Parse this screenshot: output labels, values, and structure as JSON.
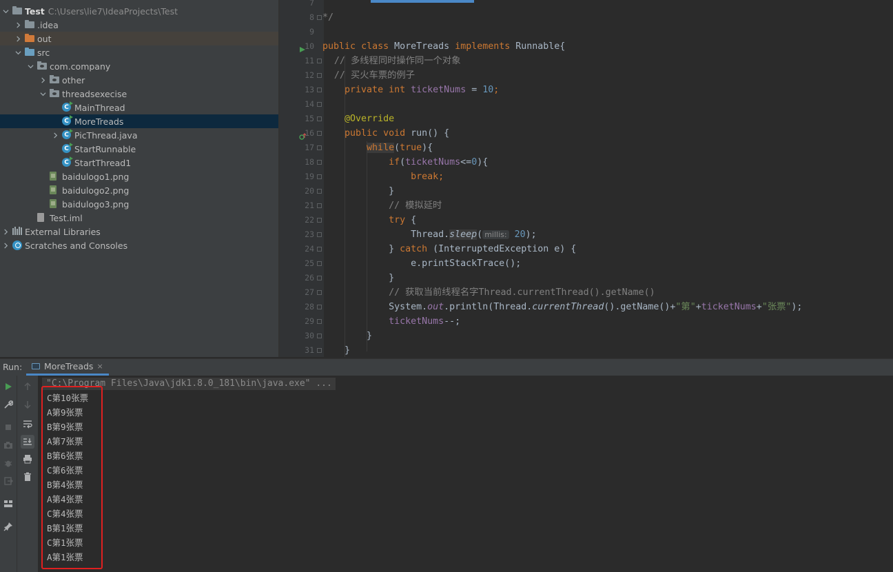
{
  "project_tree": [
    {
      "name": "Test",
      "path": "C:\\Users\\lie7\\IdeaProjects\\Test",
      "icon": "module-folder-icon",
      "expanded": true,
      "bold": true,
      "depth": 0,
      "key": "test-root"
    },
    {
      "name": ".idea",
      "icon": "folder-icon",
      "expanded": false,
      "depth": 1,
      "key": "idea"
    },
    {
      "name": "out",
      "icon": "output-folder-icon",
      "expanded": false,
      "depth": 1,
      "key": "out"
    },
    {
      "name": "src",
      "icon": "source-folder-icon",
      "expanded": true,
      "depth": 1,
      "key": "src"
    },
    {
      "name": "com.company",
      "icon": "package-icon",
      "expanded": true,
      "depth": 2,
      "key": "com-company"
    },
    {
      "name": "other",
      "icon": "package-icon",
      "expanded": false,
      "depth": 3,
      "key": "other"
    },
    {
      "name": "threadsexecise",
      "icon": "package-icon",
      "expanded": true,
      "depth": 3,
      "key": "threadsexecise"
    },
    {
      "name": "MainThread",
      "icon": "java-class-icon",
      "depth": 4,
      "key": "mainthread"
    },
    {
      "name": "MoreTreads",
      "icon": "java-class-icon",
      "depth": 4,
      "selected": true,
      "key": "moretreads"
    },
    {
      "name": "PicThread.java",
      "icon": "java-class-icon",
      "expanded": false,
      "depth": 4,
      "key": "picthread"
    },
    {
      "name": "StartRunnable",
      "icon": "java-class-icon",
      "depth": 4,
      "key": "startrunnable"
    },
    {
      "name": "StartThread1",
      "icon": "java-class-icon",
      "depth": 4,
      "key": "startthread1"
    },
    {
      "name": "baidulogo1.png",
      "icon": "image-file-icon",
      "depth": 3,
      "key": "baidulogo1"
    },
    {
      "name": "baidulogo2.png",
      "icon": "image-file-icon",
      "depth": 3,
      "key": "baidulogo2"
    },
    {
      "name": "baidulogo3.png",
      "icon": "image-file-icon",
      "depth": 3,
      "key": "baidulogo3"
    },
    {
      "name": "Test.iml",
      "icon": "iml-file-icon",
      "depth": 2,
      "key": "test-iml"
    },
    {
      "name": "External Libraries",
      "icon": "library-icon",
      "expanded": false,
      "depth": 0,
      "key": "external-libraries"
    },
    {
      "name": "Scratches and Consoles",
      "icon": "scratches-icon",
      "expanded": false,
      "depth": 0,
      "key": "scratches"
    }
  ],
  "editor": {
    "line_numbers": [
      "7",
      "8",
      "9",
      "10",
      "11",
      "12",
      "13",
      "14",
      "15",
      "16",
      "17",
      "18",
      "19",
      "20",
      "21",
      "22",
      "23",
      "24",
      "25",
      "26",
      "27",
      "28",
      "29",
      "30",
      "31"
    ],
    "code": {
      "l8": "*/",
      "l10_public": "public",
      "l10_class": "class",
      "l10_name": "MoreTreads",
      "l10_impl": "implements",
      "l10_iface": "Runnable{",
      "l11": "// 多线程同时操作同一个对象",
      "l12": "// 买火车票的例子",
      "l13_kw1": "private",
      "l13_kw2": "int",
      "l13_field": "ticketNums",
      "l13_eq": " = ",
      "l13_num": "10",
      "l13_end": ";",
      "l15": "@Override",
      "l16_kw1": "public",
      "l16_kw2": "void",
      "l16_rest": "run() {",
      "l17_kw": "while",
      "l17_open": "(",
      "l17_true": "true",
      "l17_close": "){",
      "l18_if": "if",
      "l18_open": "(",
      "l18_field": "ticketNums",
      "l18_op": "<=",
      "l18_num": "0",
      "l18_close": "){",
      "l19": "break;",
      "l20": "}",
      "l21": "// 模拟延时",
      "l22_try": "try",
      "l22_brace": " {",
      "l23_thread": "Thread.",
      "l23_sleep": "sleep",
      "l23_paren": "(",
      "l23_hint": "millis:",
      "l23_num": "20",
      "l23_end": ");",
      "l24_close": "} ",
      "l24_catch": "catch",
      "l24_rest": " (InterruptedException e) {",
      "l25": "e.printStackTrace();",
      "l26": "}",
      "l27": "// 获取当前线程名字Thread.currentThread().getName()",
      "l28_a": "System.",
      "l28_out": "out",
      "l28_b": ".println(Thread.",
      "l28_ct": "currentThread",
      "l28_c": "().getName()+",
      "l28_s1": "\"第\"",
      "l28_plus1": "+",
      "l28_field": "ticketNums",
      "l28_plus2": "+",
      "l28_s2": "\"张票\"",
      "l28_end": ");",
      "l29_field": "ticketNums",
      "l29_end": "--;",
      "l30": "}",
      "l31": "}"
    }
  },
  "run_panel": {
    "label": "Run:",
    "tab_name": "MoreTreads",
    "tab_close": "×",
    "command": "\"C:\\Program Files\\Java\\jdk1.8.0_181\\bin\\java.exe\" ...",
    "output": [
      "C第10张票",
      "A第9张票",
      "B第9张票",
      "A第7张票",
      "B第6张票",
      "C第6张票",
      "B第4张票",
      "A第4张票",
      "C第4张票",
      "B第1张票",
      "C第1张票",
      "A第1张票"
    ],
    "left_toolbar_icons": [
      "run-icon",
      "wrench-icon",
      "stop-icon",
      "camera-icon",
      "debug-icon",
      "exit-icon",
      "layout-icon",
      "pin-icon"
    ],
    "second_toolbar_icons": [
      "up-arrow-icon",
      "down-arrow-icon",
      "soft-wrap-icon",
      "scroll-to-end-icon",
      "print-icon",
      "trash-icon"
    ]
  },
  "colors": {
    "highlight_box": "#e02020",
    "selection": "#0d293e",
    "keyword": "#cc7832",
    "number": "#6897bb",
    "field": "#9876aa",
    "string": "#6a8759",
    "annotation": "#bbb529"
  }
}
